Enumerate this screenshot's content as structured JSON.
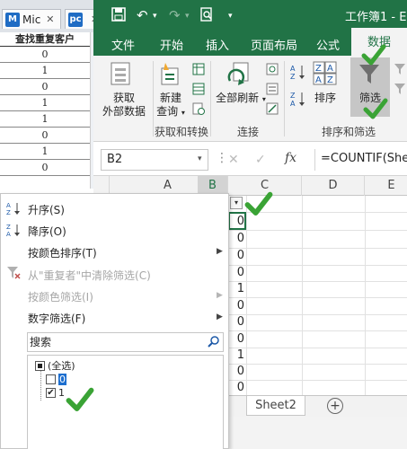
{
  "background_window": {
    "tabs": [
      {
        "logo": "M",
        "title": "Mic",
        "color": "#1f6cc4"
      },
      {
        "logo": "pc",
        "title": "",
        "color": "#1f6cc4"
      }
    ],
    "table_header": "查找重复客户",
    "values": [
      "0",
      "1",
      "0",
      "1",
      "1",
      "0",
      "1",
      "0"
    ]
  },
  "excel": {
    "title": "工作簿1 - E",
    "ribbon_tabs": [
      "文件",
      "开始",
      "插入",
      "页面布局",
      "公式",
      "数据"
    ],
    "active_tab": "数据",
    "ribbon": {
      "get_external_data": [
        "获取",
        "外部数据"
      ],
      "new_query": [
        "新建",
        "查询"
      ],
      "refresh_all": "全部刷新",
      "sort": "排序",
      "filter": "筛选",
      "groups": [
        "获取和转换",
        "连接",
        "排序和筛选"
      ],
      "az_top": "A Z",
      "za_top": "Z A"
    },
    "name_box": "B2",
    "fx_label": "fx",
    "formula": "=COUNTIF(Shee",
    "columns": [
      "A",
      "B",
      "C",
      "D",
      "E"
    ],
    "column_b_values": [
      "0",
      "0",
      "0",
      "0",
      "1",
      "0",
      "0",
      "0",
      "1",
      "0",
      "0"
    ],
    "sheet_tab": "Sheet2",
    "add_sheet": "+"
  },
  "filter_menu": {
    "items": [
      {
        "label": "升序(S)",
        "icon": "sort-az-icon",
        "disabled": false,
        "submenu": false
      },
      {
        "label": "降序(O)",
        "icon": "sort-za-icon",
        "disabled": false,
        "submenu": false
      },
      {
        "label": "按颜色排序(T)",
        "icon": "",
        "disabled": false,
        "submenu": true
      },
      {
        "label": "从\"重复者\"中清除筛选(C)",
        "icon": "clear-filter-icon",
        "disabled": true,
        "submenu": false
      },
      {
        "label": "按颜色筛选(I)",
        "icon": "",
        "disabled": true,
        "submenu": true
      },
      {
        "label": "数字筛选(F)",
        "icon": "",
        "disabled": false,
        "submenu": true
      }
    ],
    "search_placeholder": "搜索",
    "checklist": [
      {
        "label": "(全选)",
        "state": "partial"
      },
      {
        "label": "0",
        "state": "unchecked"
      },
      {
        "label": "1",
        "state": "checked"
      }
    ]
  },
  "colors": {
    "excel_green": "#217346",
    "check_green": "#3aa335"
  }
}
